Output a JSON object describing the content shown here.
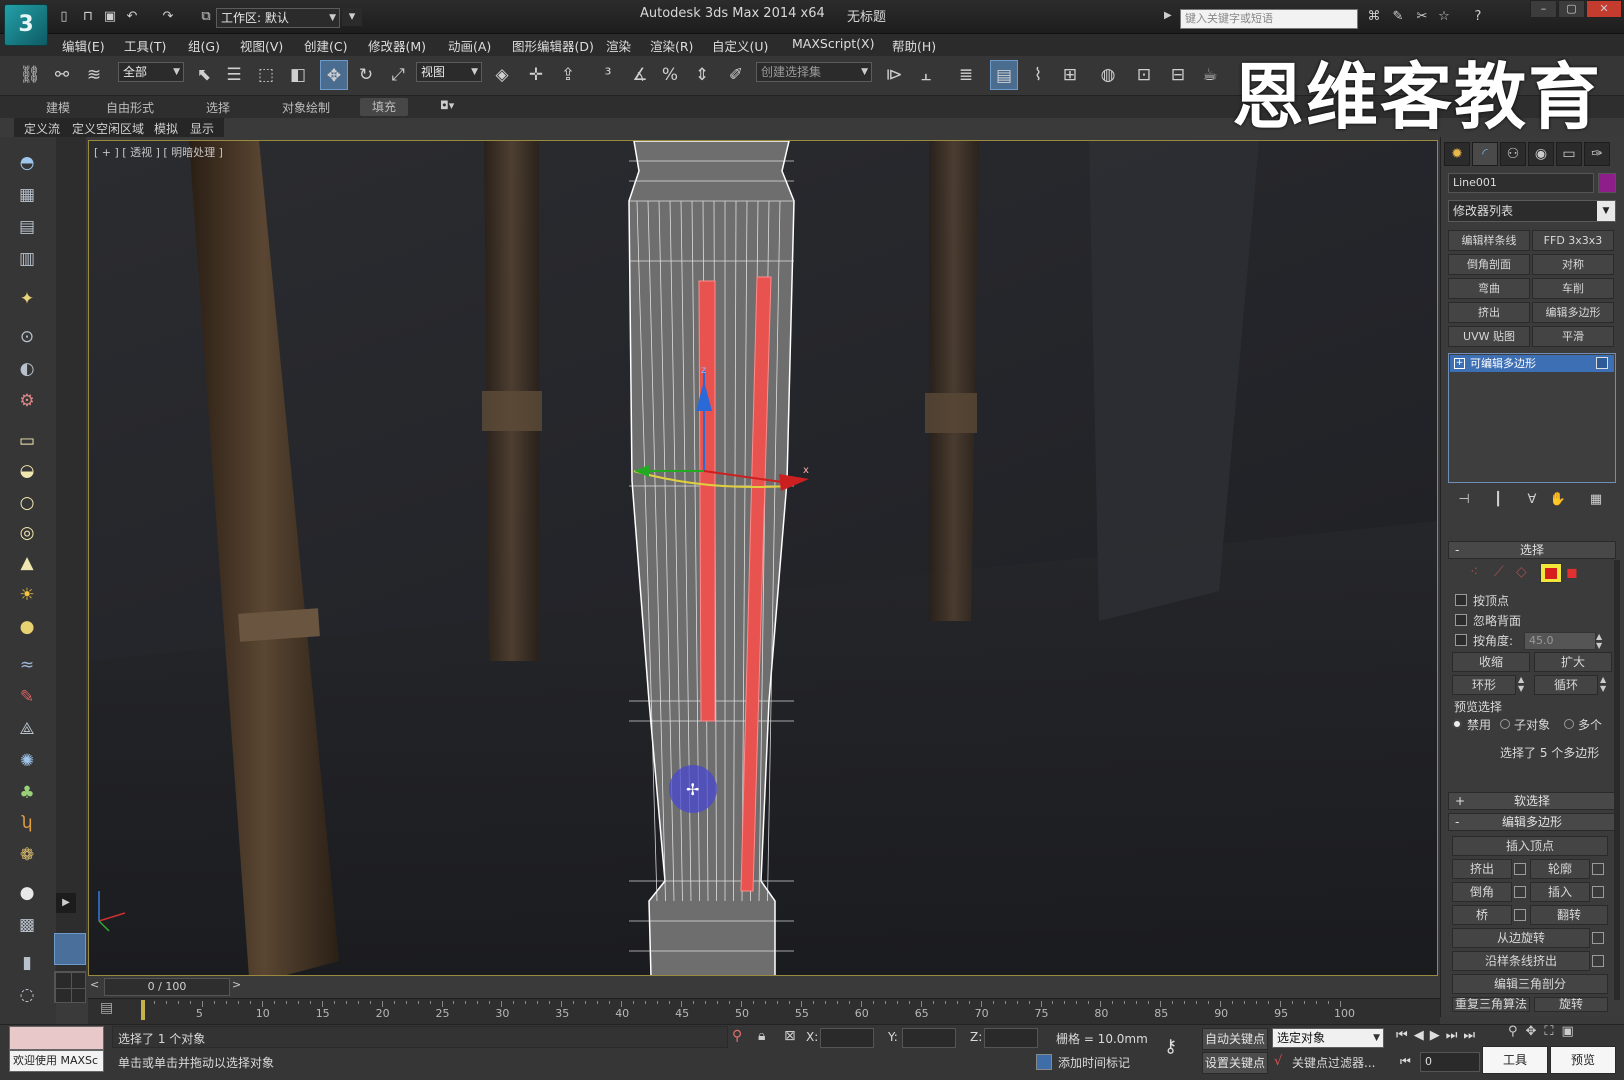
{
  "title_bar": {
    "app_title": "Autodesk 3ds Max  2014 x64",
    "file_name": "无标题",
    "workspace_label": "工作区: 默认",
    "search_placeholder": "键入关键字或短语"
  },
  "menu": [
    "编辑(E)",
    "工具(T)",
    "组(G)",
    "视图(V)",
    "创建(C)",
    "修改器(M)",
    "动画(A)",
    "图形编辑器(D)",
    "渲染",
    "渲染(R)",
    "自定义(U)",
    "MAXScript(X)",
    "帮助(H)"
  ],
  "toolbar": {
    "filter_value": "全部",
    "coord_system": "视图",
    "named_selection_placeholder": "创建选择集"
  },
  "watermark": "恩维客教育",
  "ribbon": {
    "tabs": [
      "建模",
      "自由形式",
      "选择",
      "对象绘制",
      "填充"
    ],
    "active_tab": "填充",
    "sub_tabs": [
      "定义流",
      "定义空闲区域",
      "模拟",
      "显示"
    ]
  },
  "viewport": {
    "label": "[ + ] [ 透视 ] [ 明暗处理 ]",
    "gizmo_axes": [
      "z",
      "x"
    ]
  },
  "command_panel": {
    "object_name": "Line001",
    "object_color": "#8e1f8a",
    "modifier_list": "修改器列表",
    "modifier_buttons": [
      "编辑样条线",
      "FFD 3x3x3",
      "倒角剖面",
      "对称",
      "弯曲",
      "车削",
      "挤出",
      "编辑多边形",
      "UVW 贴图",
      "平滑"
    ],
    "stack_item": "可编辑多边形",
    "selection": {
      "header": "选择",
      "by_vertex": "按顶点",
      "ignore_backfacing": "忽略背面",
      "by_angle": "按角度:",
      "angle_value": "45.0",
      "shrink": "收缩",
      "grow": "扩大",
      "ring": "环形",
      "loop": "循环",
      "preview_label": "预览选择",
      "preview_options": [
        "禁用",
        "子对象",
        "多个"
      ],
      "status": "选择了 5 个多边形"
    },
    "soft_selection": "软选择",
    "edit_polygons": {
      "header": "编辑多边形",
      "insert_vertex": "插入顶点",
      "extrude": "挤出",
      "outline": "轮廓",
      "bevel": "倒角",
      "inset": "插入",
      "bridge": "桥",
      "flip": "翻转",
      "hinge_from_edge": "从边旋转",
      "extrude_along_spline": "沿样条线挤出",
      "edit_triangulation": "编辑三角剖分",
      "retriangulate": "重复三角算法",
      "turn": "旋转"
    }
  },
  "timeline": {
    "frame_display": "0 / 100",
    "ticks": [
      5,
      10,
      15,
      20,
      25,
      30,
      35,
      40,
      45,
      50,
      55,
      60,
      65,
      70,
      75,
      80,
      85,
      90,
      95,
      100
    ]
  },
  "status_bar": {
    "welcome": "欢迎使用 MAXSc",
    "selected": "选择了 1 个对象",
    "prompt": "单击或单击并拖动以选择对象",
    "x_label": "X:",
    "y_label": "Y:",
    "z_label": "Z:",
    "grid": "栅格 = 10.0mm",
    "auto_key": "自动关键点",
    "set_key": "设置关键点",
    "key_mode": "选定对象",
    "key_filters": "关键点过滤器...",
    "add_time_tag": "添加时间标记",
    "frame_value": "0",
    "tools_btn": "工具",
    "preview_btn": "预览"
  }
}
